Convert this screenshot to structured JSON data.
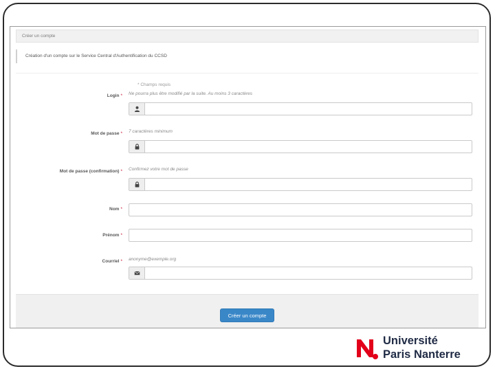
{
  "panel": {
    "heading": "Créer un compte",
    "info": "Création d'un compte sur le Service Central d'Authentification du CCSD"
  },
  "form": {
    "required_note": "* Champs requis",
    "required_marker": "*",
    "fields": [
      {
        "label": "Login",
        "help": "Ne pourra plus être modifié par la suite. Au moins 3 caractères",
        "icon": "user-icon",
        "value": ""
      },
      {
        "label": "Mot de passe",
        "help": "7 caractères minimum",
        "icon": "lock-icon",
        "value": ""
      },
      {
        "label": "Mot de passe (confirmation)",
        "help": "Confirmez votre mot de passe",
        "icon": "lock-icon",
        "value": ""
      },
      {
        "label": "Nom",
        "help": "",
        "icon": "",
        "value": ""
      },
      {
        "label": "Prénom",
        "help": "",
        "icon": "",
        "value": ""
      },
      {
        "label": "Courriel",
        "help": "anonyme@exemple.org",
        "icon": "envelope-icon",
        "value": ""
      }
    ],
    "submit_label": "Créer un compte",
    "accent_color": "#3a87c8",
    "required_color": "#c8102e"
  },
  "logo": {
    "line1": "Université",
    "line2": "Paris Nanterre",
    "brand_color": "#e2001a"
  }
}
